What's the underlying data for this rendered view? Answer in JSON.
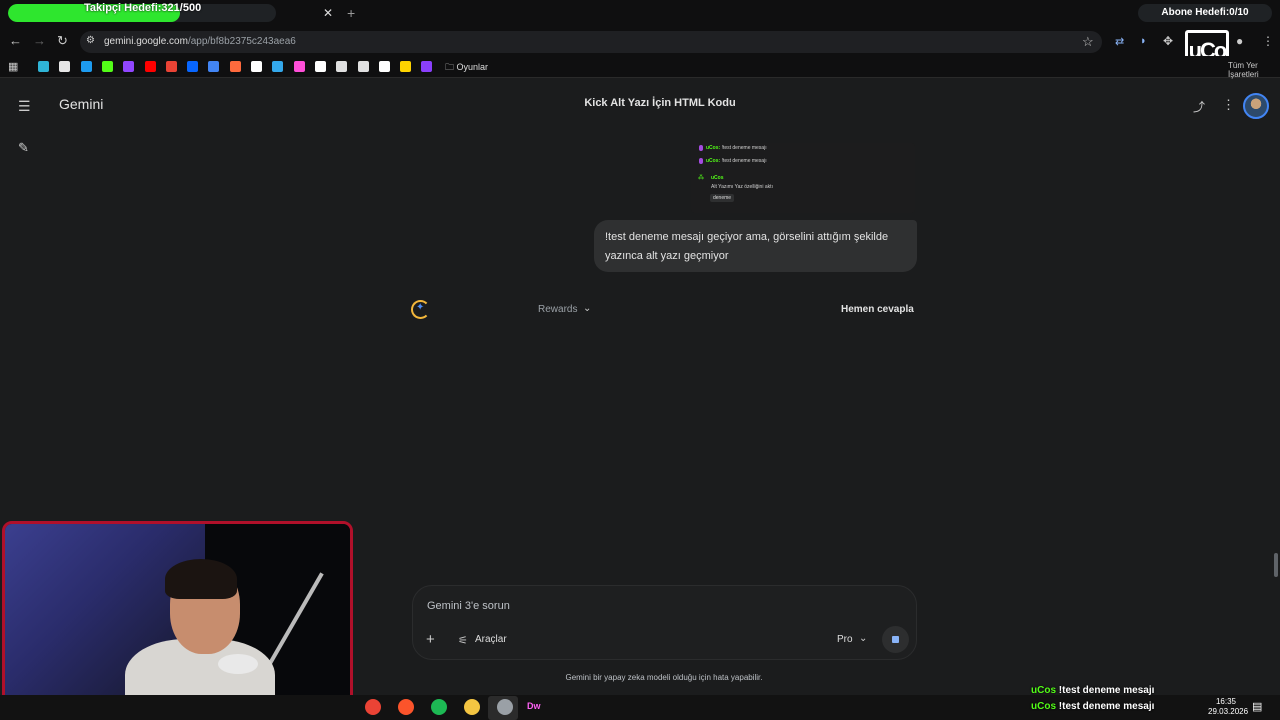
{
  "browser": {
    "follower_goal": {
      "label": "Takipçi Hedefi:321/500",
      "current": 321,
      "target": 500
    },
    "subscriber_goal": {
      "label": "Abone Hedefi:0/10",
      "current": 0,
      "target": 10
    },
    "tab": {
      "close_glyph": "✕",
      "new_tab_glyph": "+"
    },
    "url": {
      "host": "gemini.google.com",
      "path": "/app/bf8b2375c243aea6"
    },
    "bookmarks": {
      "folder_label": "Oyunlar",
      "other_label": "Tüm Yer İşaretleri",
      "icon_colors": [
        "#2fb4d6",
        "#e6e6e6",
        "#1d9bf0",
        "#53fc18",
        "#9146ff",
        "#ff0000",
        "#ea4335",
        "#0866ff",
        "#4285f4",
        "#ff6a3d",
        "#ffffff",
        "#34a8eb",
        "#ff4fd8",
        "#ffffff",
        "#e0e0e0",
        "#e0e0e0",
        "#ffffff",
        "#ffd400",
        "#8a3ffc"
      ]
    },
    "extension_logo": "uCo"
  },
  "gemini": {
    "brand": "Gemini",
    "chat_title": "Kick Alt Yazı İçin HTML Kodu",
    "attachment": {
      "lines": [
        {
          "user": "uCos:",
          "text": "!test deneme mesajı"
        },
        {
          "user": "uCos:",
          "text": "!test deneme mesajı"
        }
      ],
      "alert_user": "uCos",
      "alert_text": "Alt Yazımı Yaz özelliğini aktı",
      "alert_value": "deneme"
    },
    "user_message": "!test deneme mesajı geçiyor ama, görselini attığım şekilde yazınca alt yazı geçmiyor",
    "thinking_label": "Rewards",
    "answer_now_label": "Hemen cevapla",
    "input_placeholder": "Gemini 3'e sorun",
    "tools_label": "Araçlar",
    "model_label": "Pro",
    "disclaimer": "Gemini bir yapay zeka modeli olduğu için hata yapabilir."
  },
  "overlay": {
    "chat": [
      {
        "user": "uCos",
        "text": "!test deneme mesajı"
      },
      {
        "user": "uCos",
        "text": "!test deneme mesajı"
      }
    ]
  },
  "taskbar": {
    "app_colors": [
      "#ea4335",
      "#fb542b",
      "#1db954",
      "#f4c542",
      "#9aa0a6"
    ],
    "dw_label": "Dw",
    "time": "16:35",
    "date": "29.03.2026"
  }
}
